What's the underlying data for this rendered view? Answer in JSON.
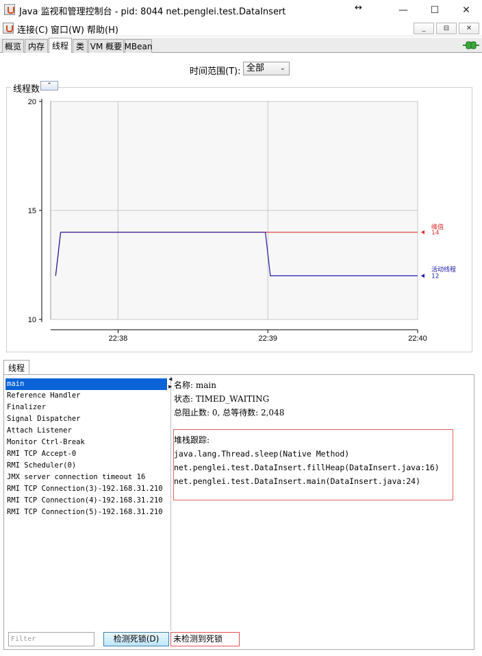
{
  "window": {
    "title": "Java 监视和管理控制台 - pid: 8044 net.penglei.test.DataInsert",
    "minimize_glyph": "—",
    "maximize_glyph": "☐",
    "close_glyph": "✕",
    "resize_glyph": "↔"
  },
  "menu": {
    "items": [
      "连接(C)",
      "窗口(W)",
      "帮助(H)"
    ],
    "mdi_buttons": [
      "_",
      "⊟",
      "✕"
    ]
  },
  "tabs": [
    "概览",
    "内存",
    "线程",
    "类",
    "VM 概要",
    "MBean"
  ],
  "active_tab": "线程",
  "time_range": {
    "label": "时间范围(T):",
    "selected": "全部",
    "arrow": "⌄"
  },
  "chart_panel": {
    "title": "线程数",
    "collapse_glyph": "⌃"
  },
  "chart_data": {
    "type": "line",
    "xlabel": "",
    "ylabel": "",
    "x_ticks": [
      "22:38",
      "22:39",
      "22:40"
    ],
    "y_ticks": [
      10,
      15,
      20
    ],
    "ylim": [
      10,
      20
    ],
    "grid": true,
    "legend_position": "right",
    "series": [
      {
        "name": "峰值",
        "color": "#e03030",
        "points": [
          [
            "22:37:35",
            12
          ],
          [
            "22:37:37",
            14
          ],
          [
            "22:38:59",
            14
          ],
          [
            "22:40:00",
            14
          ]
        ],
        "end_value": "14"
      },
      {
        "name": "活动线程",
        "color": "#1a1aa8",
        "points": [
          [
            "22:37:35",
            12
          ],
          [
            "22:37:37",
            14
          ],
          [
            "22:38:59",
            14
          ],
          [
            "22:39:01",
            12
          ],
          [
            "22:40:00",
            12
          ]
        ],
        "end_value": "12"
      }
    ]
  },
  "lower_tab": "线程",
  "threads": [
    "main",
    "Reference Handler",
    "Finalizer",
    "Signal Dispatcher",
    "Attach Listener",
    "Monitor Ctrl-Break",
    "RMI TCP Accept-0",
    "RMI Scheduler(0)",
    "JMX server connection timeout 16",
    "RMI TCP Connection(3)-192.168.31.210",
    "RMI TCP Connection(4)-192.168.31.210",
    "RMI TCP Connection(5)-192.168.31.210"
  ],
  "selected_thread_index": 0,
  "detail": {
    "name_line": "名称: main",
    "state_line": "状态: TIMED_WAITING",
    "counts_line": "总阻止数: 0, 总等待数: 2,048",
    "stack_title": "堆栈跟踪:",
    "stack": [
      "java.lang.Thread.sleep(Native Method)",
      "net.penglei.test.DataInsert.fillHeap(DataInsert.java:16)",
      "net.penglei.test.DataInsert.main(DataInsert.java:24)"
    ]
  },
  "footer": {
    "filter_placeholder": "Filter",
    "detect_button": "检测死锁(D)",
    "detect_status": "未检测到死锁"
  }
}
